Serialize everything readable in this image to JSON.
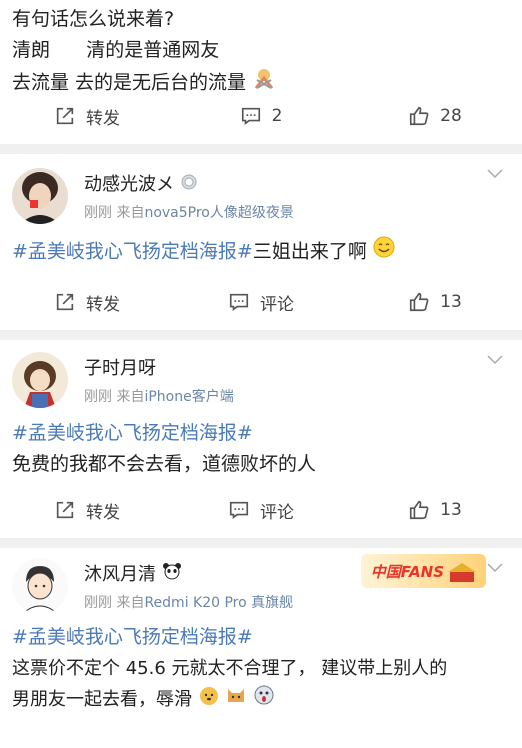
{
  "post0": {
    "lines": [
      "有句话怎么说来着?",
      "清朗      清的是普通网友",
      "去流量 去的是无后台的流量"
    ],
    "actions": {
      "repost": "转发",
      "comment": "2",
      "like": "28"
    }
  },
  "post1": {
    "user": "动感光波メ",
    "time": "刚刚",
    "source_prefix": "来自",
    "source": "nova5Pro人像超级夜景",
    "topic": "#孟美岐我心飞扬定档海报#",
    "text": "三姐出来了啊",
    "actions": {
      "repost": "转发",
      "comment": "评论",
      "like": "13"
    }
  },
  "post2": {
    "user": "子时月呀",
    "time": "刚刚",
    "source_prefix": "来自",
    "source": "iPhone客户端",
    "topic": "#孟美岐我心飞扬定档海报#",
    "text": "免费的我都不会去看，道德败坏的人",
    "actions": {
      "repost": "转发",
      "comment": "评论",
      "like": "13"
    }
  },
  "post3": {
    "user": "沐风月清",
    "time": "刚刚",
    "source_prefix": "来自",
    "source": "Redmi K20 Pro 真旗舰",
    "topic": "#孟美岐我心飞扬定档海报#",
    "text_line1": "这票价不定个 45.6 元就太不合理了， 建议带上别人的",
    "text_line2": "男朋友一起去看，辱滑",
    "badge": "中国FANS"
  },
  "colors": {
    "topic": "#4a7ab8",
    "source": "#6a86a8",
    "badge": "#e8352b"
  }
}
